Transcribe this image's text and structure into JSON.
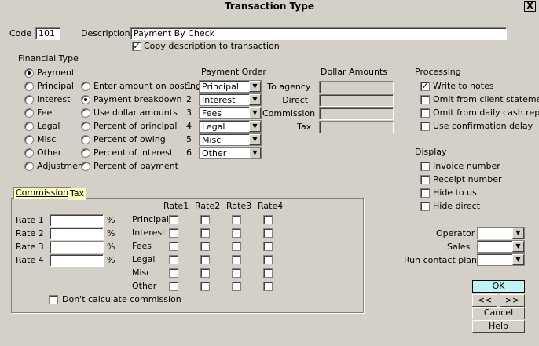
{
  "window": {
    "title": "Transaction Type",
    "close_label": "X"
  },
  "code": {
    "label": "Code",
    "value": "101"
  },
  "description": {
    "label": "Description",
    "value": "Payment By Check",
    "copy_label": "Copy description to transaction",
    "copy_checked": true
  },
  "financial_type": {
    "label": "Financial Type",
    "options": [
      "Payment",
      "Principal",
      "Interest",
      "Fee",
      "Legal",
      "Misc",
      "Other",
      "Adjustment"
    ],
    "selected": "Payment"
  },
  "entry_mode": {
    "options": [
      "Enter amount on posting",
      "Payment breakdown",
      "Use dollar amounts",
      "Percent of principal",
      "Percent of owing",
      "Percent of interest",
      "Percent of payment"
    ],
    "selected": "Payment breakdown"
  },
  "payment_order": {
    "label": "Payment Order",
    "rows": [
      {
        "num": "1",
        "value": "Principal"
      },
      {
        "num": "2",
        "value": "Interest"
      },
      {
        "num": "3",
        "value": "Fees"
      },
      {
        "num": "4",
        "value": "Legal"
      },
      {
        "num": "5",
        "value": "Misc"
      },
      {
        "num": "6",
        "value": "Other"
      }
    ]
  },
  "dollar_amounts": {
    "label": "Dollar Amounts",
    "rows": [
      "To agency",
      "Direct",
      "Commission",
      "Tax"
    ]
  },
  "processing": {
    "label": "Processing",
    "items": [
      {
        "label": "Write to notes",
        "checked": true
      },
      {
        "label": "Omit from client statement",
        "checked": false
      },
      {
        "label": "Omit from daily cash report",
        "checked": false
      },
      {
        "label": "Use confirmation delay",
        "checked": false
      }
    ]
  },
  "display": {
    "label": "Display",
    "items": [
      "Invoice number",
      "Receipt number",
      "Hide to us",
      "Hide direct"
    ]
  },
  "tabs": [
    "Commission",
    "Tax"
  ],
  "commission": {
    "rates": [
      "Rate 1",
      "Rate 2",
      "Rate 3",
      "Rate 4"
    ],
    "percent": "%",
    "columns": [
      "Rate1",
      "Rate2",
      "Rate3",
      "Rate4"
    ],
    "categories": [
      "Principal",
      "Interest",
      "Fees",
      "Legal",
      "Misc",
      "Other"
    ],
    "dont_calc_label": "Don't calculate commission"
  },
  "assign": {
    "operator": "Operator",
    "sales": "Sales",
    "contact_plan": "Run contact plan"
  },
  "buttons": {
    "ok": "OK",
    "prev": "<<",
    "next": ">>",
    "cancel": "Cancel",
    "help": "Help"
  }
}
